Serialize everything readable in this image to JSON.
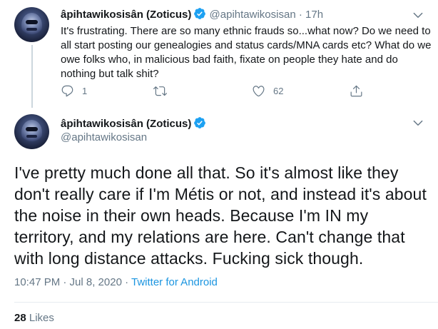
{
  "tweet1": {
    "name": "âpihtawikosisân (Zoticus)",
    "handle": "@apihtawikosisan",
    "separator": "·",
    "time": "17h",
    "text": "It's frustrating. There are so many ethnic frauds so...what now? Do we need to all start posting our genealogies and status cards/MNA cards etc? What do we owe folks who, in malicious bad faith, fixate on people they hate and do nothing but talk shit?",
    "reply_count": "1",
    "like_count": "62"
  },
  "tweet2": {
    "name": "âpihtawikosisân (Zoticus)",
    "handle": "@apihtawikosisan",
    "text": "I've pretty much done all that. So it's almost like they don't really care if I'm Métis or not, and instead it's about the noise in their own heads. Because I'm IN my territory, and my relations are here. Can't change that with long distance attacks. Fucking sick though.",
    "timestamp": "10:47 PM · Jul 8, 2020",
    "separator": " · ",
    "source": "Twitter for Android",
    "likes_count": "28",
    "likes_label": "Likes"
  },
  "colors": {
    "accent": "#1da1f2",
    "source_link": "#1b95e0",
    "secondary_text": "#657786",
    "primary_text": "#14171a"
  },
  "icons": [
    "verified-badge-icon",
    "chevron-down-icon",
    "reply-icon",
    "retweet-icon",
    "like-icon",
    "share-icon"
  ]
}
